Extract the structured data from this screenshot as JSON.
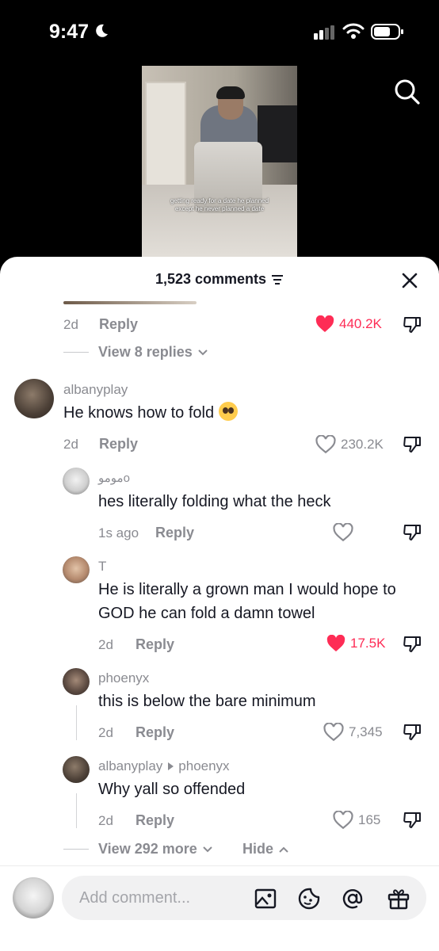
{
  "status_bar": {
    "time": "9:47"
  },
  "video": {
    "caption": "getting ready for a date he planned except he never planned a date"
  },
  "sheet": {
    "comment_count": "1,523 comments"
  },
  "top_comment": {
    "time": "2d",
    "reply_label": "Reply",
    "likes": "440.2K",
    "liked": true,
    "view_replies": "View 8 replies"
  },
  "comment": {
    "username": "albanyplay",
    "text": "He knows how to fold",
    "time": "2d",
    "reply_label": "Reply",
    "likes": "230.2K",
    "liked": false
  },
  "replies": [
    {
      "username": "موموo",
      "text": "hes literally folding what the heck",
      "time": "1s ago",
      "reply_label": "Reply",
      "likes": "",
      "liked": false
    },
    {
      "username": "T",
      "text": "He is literally a grown man I would hope to GOD he can fold a damn towel",
      "time": "2d",
      "reply_label": "Reply",
      "likes": "17.5K",
      "liked": true
    },
    {
      "username": "phoenyx",
      "text": "this is below the bare minimum",
      "time": "2d",
      "reply_label": "Reply",
      "likes": "7,345",
      "liked": false
    },
    {
      "username": "albanyplay",
      "reply_to": "phoenyx",
      "text": "Why yall so offended",
      "time": "2d",
      "reply_label": "Reply",
      "likes": "165",
      "liked": false
    }
  ],
  "more_replies": {
    "view_more": "View 292 more",
    "hide": "Hide"
  },
  "composer": {
    "placeholder": "Add comment..."
  },
  "colors": {
    "accent": "#fe2c55",
    "muted": "#8a8b91",
    "text": "#161823"
  },
  "icons": [
    "moon-icon",
    "signal-icon",
    "wifi-icon",
    "battery-icon",
    "search-icon",
    "sort-icon",
    "close-icon",
    "heart-icon",
    "dislike-icon",
    "chevron-down-icon",
    "chevron-up-icon",
    "image-icon",
    "emoji-sticker-icon",
    "at-icon",
    "gift-icon"
  ]
}
